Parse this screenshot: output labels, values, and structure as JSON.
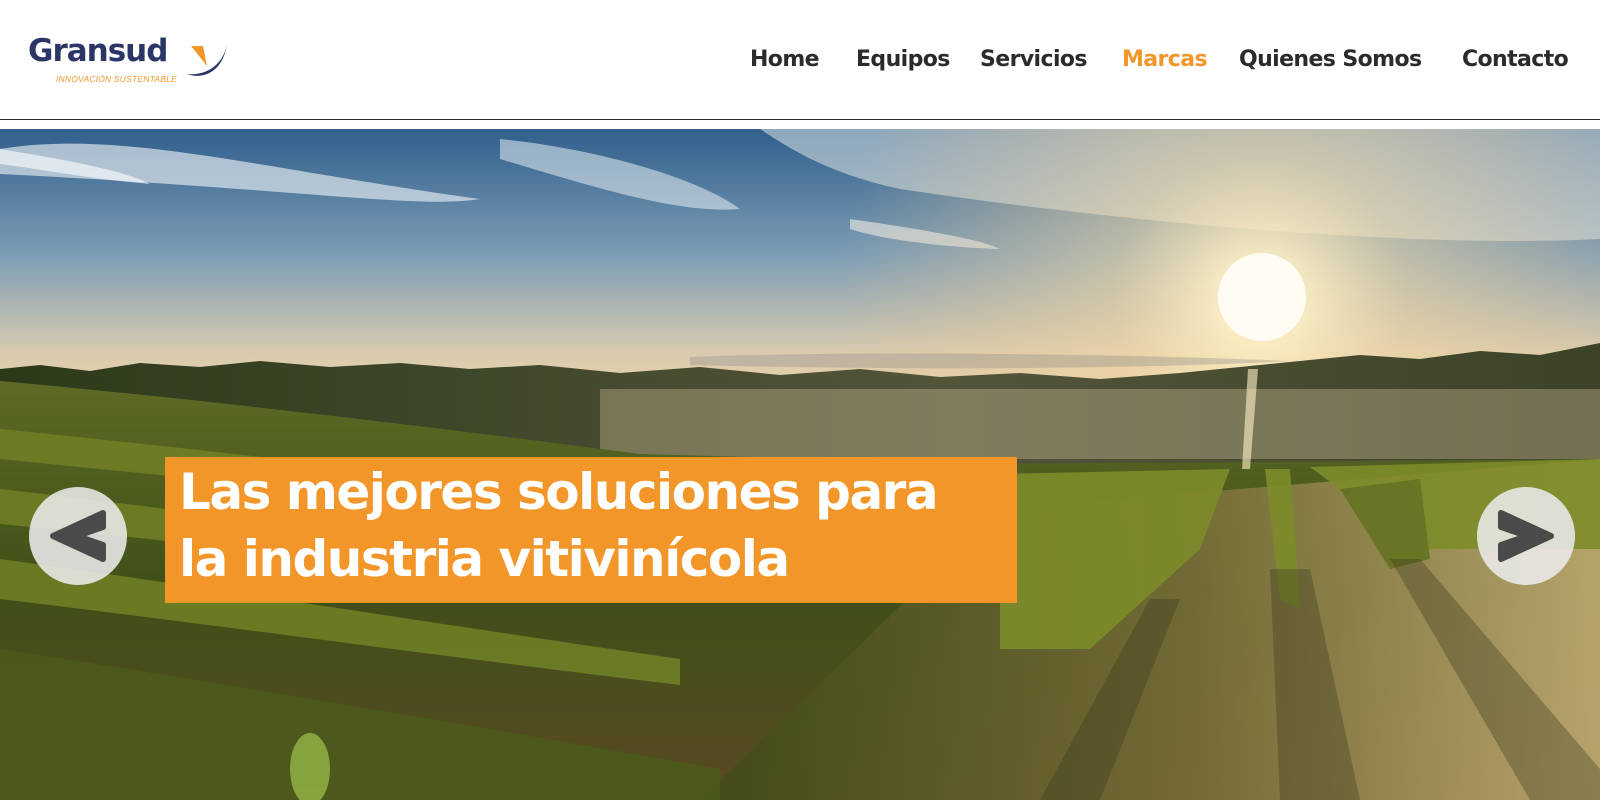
{
  "logo": {
    "name": "Gransud",
    "tagline": "INNOVACIÓN SUSTENTABLE",
    "brand_color": "#2b3566",
    "accent_color": "#f39629"
  },
  "nav": {
    "items": [
      {
        "label": "Home",
        "active": false
      },
      {
        "label": "Equipos",
        "active": false
      },
      {
        "label": "Servicios",
        "active": false
      },
      {
        "label": "Marcas",
        "active": true
      },
      {
        "label": "Quienes Somos",
        "active": false
      },
      {
        "label": "Contacto",
        "active": false
      }
    ],
    "text_color": "#2b2b2b",
    "active_color": "#f39629"
  },
  "hero": {
    "image": "vineyard-sunrise-photo",
    "headline_line1": "Las mejores soluciones para",
    "headline_line2": "la industria vitivinícola",
    "headline_bg": "#f39629",
    "prev_icon": "chevron-left-icon",
    "next_icon": "chevron-right-icon"
  }
}
